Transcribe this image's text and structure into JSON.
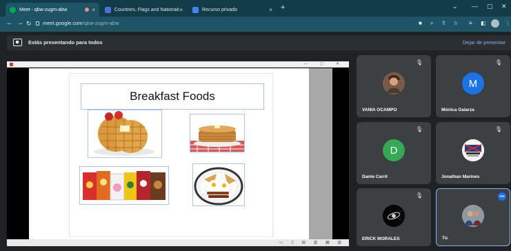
{
  "browser": {
    "tabs": [
      {
        "label": "Meet - qbw-zugm-abw",
        "close": "×"
      },
      {
        "label": "Countries, Flags and Nationaliti",
        "close": "×"
      },
      {
        "label": "Recurso privado",
        "close": "×"
      }
    ],
    "new_tab": "+",
    "url_host": "meet.google.com",
    "url_path": "/qbw-zugm-abw"
  },
  "meet": {
    "presenting_text": "Estás presentando para todos",
    "stop_presenting": "Dejar de presentar"
  },
  "slide": {
    "title": "Breakfast Foods"
  },
  "participants": [
    {
      "name": "VANIA OCAMPO",
      "type": "photo"
    },
    {
      "name": "Mónica Galarza",
      "type": "initial",
      "initial": "M",
      "color": "#1a73e8"
    },
    {
      "name": "Dante Carril",
      "type": "initial",
      "initial": "D",
      "color": "#34a853"
    },
    {
      "name": "Jonathan Marines",
      "type": "photo"
    },
    {
      "name": "ERICK MORALES",
      "type": "photo"
    },
    {
      "name": "Tú",
      "type": "photo"
    }
  ],
  "colors": {
    "chrome_dark": "#123c4a",
    "chrome_bar": "#1e5566",
    "meet_bg": "#202124",
    "tile_bg": "#3c4043",
    "accent": "#8ab4f8"
  }
}
